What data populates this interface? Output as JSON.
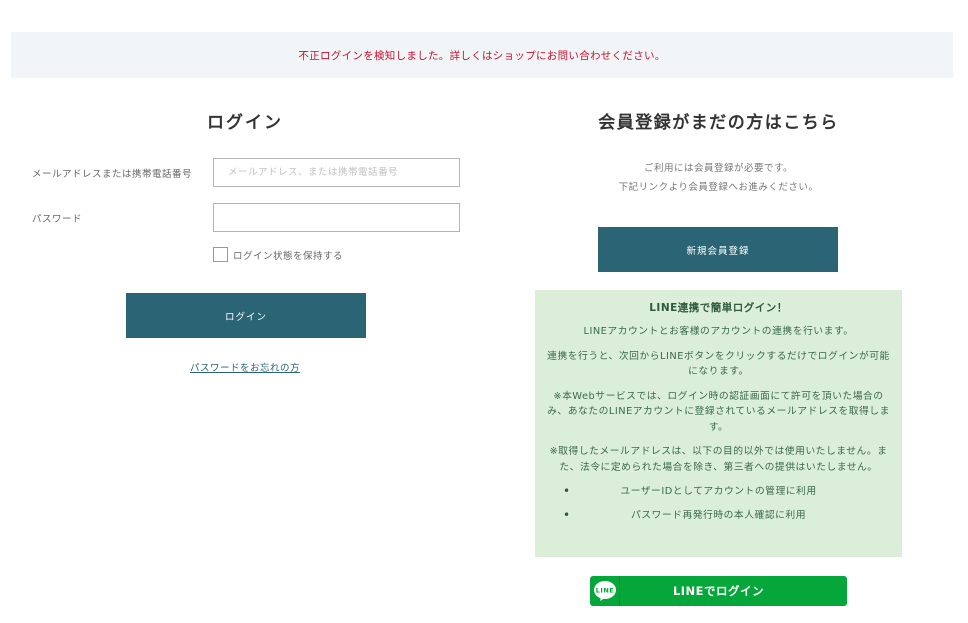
{
  "alert": {
    "message": "不正ログインを検知しました。詳しくはショップにお問い合わせください。"
  },
  "login": {
    "title": "ログイン",
    "id_label": "メールアドレスまたは携帯電話番号",
    "id_placeholder": "メールアドレス、または携帯電話番号",
    "id_value": "",
    "password_label": "パスワード",
    "password_value": "",
    "remember_label": "ログイン状態を保持する",
    "remember_checked": false,
    "submit_label": "ログイン",
    "forgot_link": "パスワードをお忘れの方"
  },
  "register": {
    "title": "会員登録がまだの方はこちら",
    "note_line1": "ご利用には会員登録が必要です。",
    "note_line2": "下記リンクより会員登録へお進みください。",
    "button_label": "新規会員登録"
  },
  "line": {
    "box_title": "LINE連携で簡単ログイン！",
    "para1": "LINEアカウントとお客様のアカウントの連携を行います。",
    "para2": "連携を行うと、次回からLINEボタンをクリックするだけでログインが可能になります。",
    "para3": "※本Webサービスでは、ログイン時の認証画面にて許可を頂いた場合のみ、あなたのLINEアカウントに登録されているメールアドレスを取得します。",
    "para4": "※取得したメールアドレスは、以下の目的以外では使用いたしません。また、法令に定められた場合を除き、第三者への提供はいたしません。",
    "purposes": [
      "ユーザーIDとしてアカウントの管理に利用",
      "パスワード再発行時の本人確認に利用"
    ],
    "login_button_label": "LINEでログイン",
    "logo_text": "LINE",
    "colors": {
      "brand": "#06a73a",
      "box_bg": "#dbeed8"
    }
  },
  "colors": {
    "primary_button": "#2a6475",
    "alert_text": "#c8102e",
    "alert_bg": "#f1f5f7"
  }
}
